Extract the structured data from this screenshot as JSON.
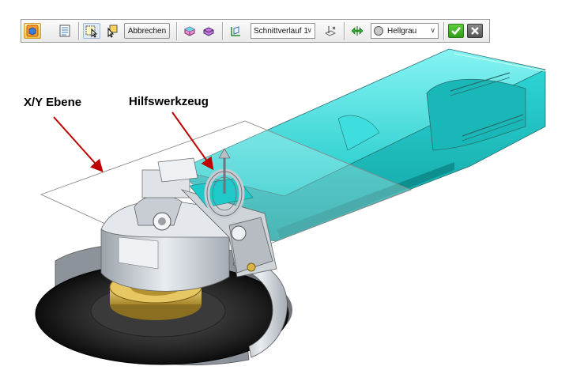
{
  "toolbar": {
    "icons": [
      "view-cube-icon",
      "section-list-icon",
      "select-plane-icon",
      "select-tool-icon",
      "solid-body-icon",
      "layered-body-icon",
      "plane-axis-icon",
      "cut-plane-icon",
      "flip-direction-icon",
      "color-swatch-icon",
      "confirm-icon",
      "cancel-icon"
    ],
    "cancel_label": "Abbrechen",
    "section_select": {
      "value": "Schnittverlauf 1"
    },
    "color_select": {
      "value": "Hellgrau"
    },
    "colors": {
      "accent": "#f3c24a",
      "confirm": "#2f9d18",
      "cancel": "#545454"
    }
  },
  "annotations": {
    "plane_label": "X/Y Ebene",
    "tool_label": "Hilfswerkzeug",
    "arrow_color": "#c00000"
  },
  "model": {
    "colors": {
      "housing": "#25d6d6",
      "metal": "#c7ccd2",
      "disc": "#1a1a1a",
      "brass": "#d8b64a"
    }
  }
}
